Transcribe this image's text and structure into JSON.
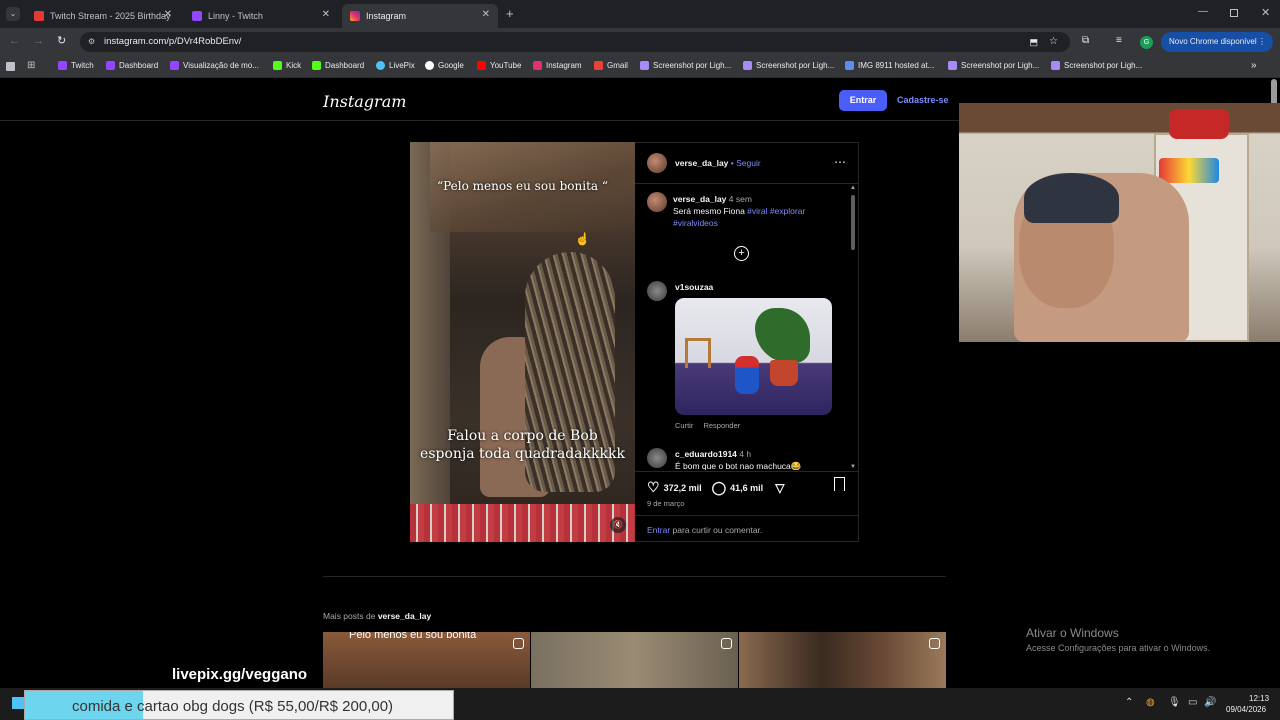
{
  "tabs": [
    {
      "label": "Twitch Stream - 2025 Birthday",
      "color": "#e53935"
    },
    {
      "label": "Linny - Twitch",
      "color": "#9146ff"
    },
    {
      "label": "Instagram",
      "color": "#e1306c",
      "active": true
    }
  ],
  "address": {
    "url": "instagram.com/p/DVr4RobDEnv/",
    "chrome_update": "Novo Chrome disponível",
    "profile_initial": "G"
  },
  "bookmarks": [
    {
      "label": "Twitch",
      "color": "#9146ff"
    },
    {
      "label": "Dashboard",
      "color": "#9146ff"
    },
    {
      "label": "Visualização de mo...",
      "color": "#9146ff"
    },
    {
      "label": "Kick",
      "color": "#53fc18"
    },
    {
      "label": "Dashboard",
      "color": "#53fc18"
    },
    {
      "label": "LivePix",
      "color": "#4fc3f7"
    },
    {
      "label": "Google",
      "color": "#ffffff"
    },
    {
      "label": "YouTube",
      "color": "#ff0000"
    },
    {
      "label": "Instagram",
      "color": "#e1306c"
    },
    {
      "label": "Gmail",
      "color": "#ea4335"
    },
    {
      "label": "Screenshot por Ligh...",
      "color": "#a78bfa"
    },
    {
      "label": "Screenshot por Ligh...",
      "color": "#a78bfa"
    },
    {
      "label": "IMG 8911 hosted at...",
      "color": "#5b8def"
    },
    {
      "label": "Screenshot por Ligh...",
      "color": "#a78bfa"
    },
    {
      "label": "Screenshot por Ligh...",
      "color": "#a78bfa"
    }
  ],
  "header": {
    "logo": "Instagram",
    "login": "Entrar",
    "signup": "Cadastre-se"
  },
  "post": {
    "username": "verse_da_lay",
    "follow": "• Seguir",
    "caption_top": "“Pelo menos eu sou bonita “",
    "caption_bottom": "Falou a corpo de Bob esponja toda quadradakkkkk",
    "author_comment": {
      "user": "verse_da_lay",
      "time": "4 sem",
      "text": "Será mesmo Fiona ",
      "tags": "#viral #explorar #viralvideos"
    },
    "comments": [
      {
        "user": "v1souzaa",
        "like": "Curtir",
        "reply": "Responder"
      },
      {
        "user": "c_eduardo1914",
        "time": "4 h",
        "text": "É bom que o bot nao machuca😂"
      }
    ],
    "likes": "372,2 mil",
    "comment_count": "41,6 mil",
    "date": "9 de março",
    "login_link": "Entrar",
    "login_prompt": " para curtir ou comentar."
  },
  "more_posts": {
    "prefix": "Mais posts de ",
    "user": "verse_da_lay",
    "thumb1_caption": "Pelo menos eu sou bonita"
  },
  "overlay": {
    "livepix": "livepix.gg/veggano",
    "donation": "comida e cartao obg dogs (R$ 55,00/R$ 200,00)",
    "donation_progress": 0.275
  },
  "windows": {
    "activate_title": "Ativar o Windows",
    "activate_sub": "Acesse Configurações para ativar o Windows.",
    "time": "12:13",
    "date": "09/04/2026"
  }
}
